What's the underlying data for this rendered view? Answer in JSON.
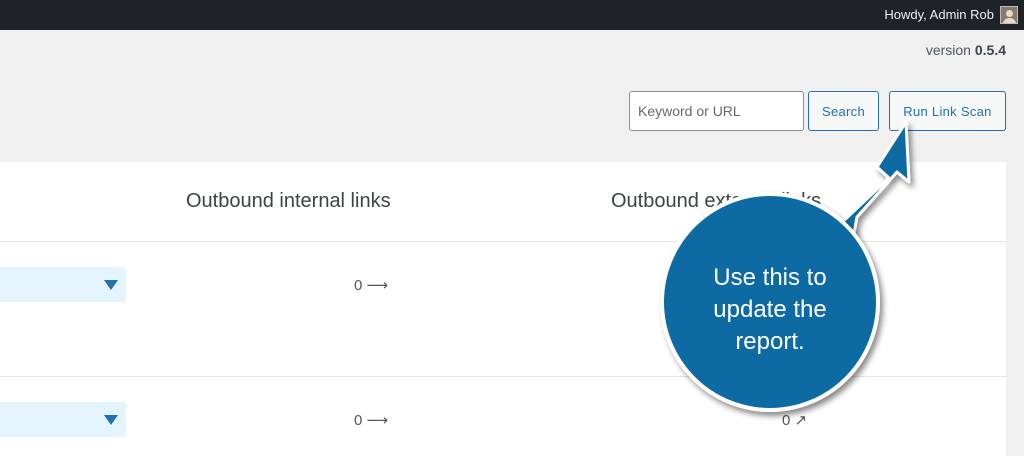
{
  "admin_bar": {
    "greeting": "Howdy, Admin Rob",
    "avatar_icon": "user-avatar"
  },
  "version": {
    "label": "version",
    "number": "0.5.4"
  },
  "search": {
    "placeholder": "Keyword or URL",
    "value": "",
    "button_label": "Search"
  },
  "scan_button_label": "Run Link Scan",
  "table": {
    "headers": {
      "internal": "Outbound internal links",
      "external": "Outbound external links"
    },
    "rows": [
      {
        "internal": "0 ⟶",
        "external": ""
      },
      {
        "internal": "0 ⟶",
        "external": "0 ↗"
      }
    ]
  },
  "callout": {
    "line1": "Use this to",
    "line2": "update the",
    "line3": "report.",
    "color": "#0b6aa3"
  },
  "colors": {
    "admin_bar": "#1d2327",
    "accent": "#2271b1",
    "dropdown_bg": "#e3f4fd"
  }
}
